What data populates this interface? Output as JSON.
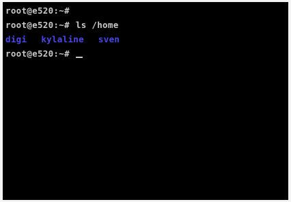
{
  "terminal": {
    "lines": [
      {
        "prompt": "root@e520:~#",
        "command": ""
      },
      {
        "prompt": "root@e520:~#",
        "command": "ls /home"
      },
      {
        "output": [
          "digi",
          "kylaline",
          "sven"
        ]
      },
      {
        "prompt": "root@e520:~#",
        "command": ""
      }
    ]
  },
  "colors": {
    "background": "#000000",
    "text": "#c8c8c8",
    "directory": "#4a48e8"
  }
}
